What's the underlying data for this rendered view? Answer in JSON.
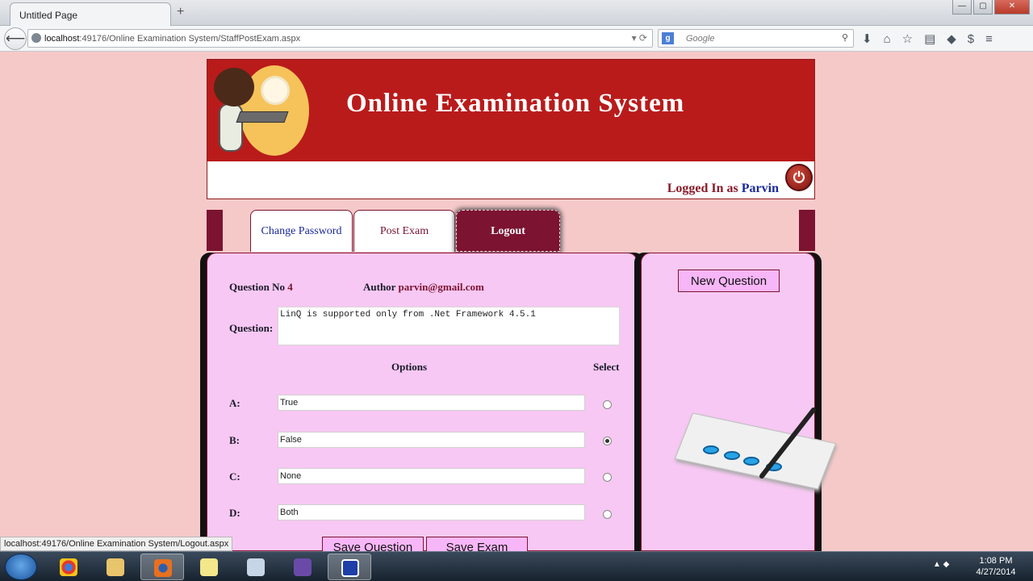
{
  "browser": {
    "tab_title": "Untitled Page",
    "url_host": "localhost",
    "url_rest": ":49176/Online Examination System/StaffPostExam.aspx",
    "search_placeholder": "Google",
    "window_buttons": {
      "minimize": "—",
      "maximize": "▢",
      "close": "✕"
    }
  },
  "header": {
    "title": "Online Examination System",
    "logged_in_prefix": "Logged In as",
    "username": "Parvin"
  },
  "menu": {
    "change_password": "Change Password",
    "post_exam": "Post Exam",
    "logout": "Logout"
  },
  "form": {
    "question_no_label": "Question No",
    "question_no": "4",
    "author_label": "Author",
    "author": "parvin@gmail.com",
    "question_label": "Question:",
    "question_text": "LinQ is supported only from .Net Framework 4.5.1",
    "options_header": "Options",
    "select_header": "Select",
    "options": [
      {
        "label": "A:",
        "value": "True",
        "selected": false
      },
      {
        "label": "B:",
        "value": "False",
        "selected": true
      },
      {
        "label": "C:",
        "value": "None",
        "selected": false
      },
      {
        "label": "D:",
        "value": "Both",
        "selected": false
      }
    ],
    "save_question": "Save Question",
    "save_exam": "Save Exam"
  },
  "side": {
    "new_question": "New Question"
  },
  "status_tip": "localhost:49176/Online Examination System/Logout.aspx",
  "taskbar": {
    "time": "1:08 PM",
    "date": "4/27/2014"
  },
  "colors": {
    "banner": "#b91b1b",
    "maroon": "#7b1331",
    "panel": "#f7c8f3",
    "page_bg": "#f6c9c9"
  }
}
